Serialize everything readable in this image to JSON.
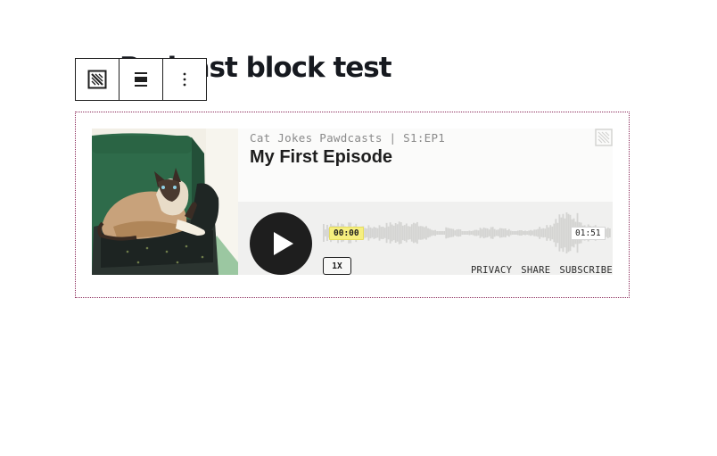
{
  "page": {
    "title": "Podcast block test"
  },
  "toolbar": {
    "items": [
      {
        "icon": "podcast-block-icon"
      },
      {
        "icon": "align-icon"
      },
      {
        "icon": "more-options-icon"
      }
    ]
  },
  "player": {
    "show_meta": "Cat Jokes Pawdcasts | S1:EP1",
    "episode_title": "My First Episode",
    "current_time": "00:00",
    "total_time": "01:51",
    "speed": "1X",
    "progress": 0,
    "links": {
      "privacy": "PRIVACY",
      "share": "SHARE",
      "subscribe": "SUBSCRIBE"
    },
    "colors": {
      "accent": "#1e1e1e",
      "highlight": "#f6ef7f",
      "background": "#f0f0ef",
      "waveform": "#d4d4d2"
    }
  }
}
